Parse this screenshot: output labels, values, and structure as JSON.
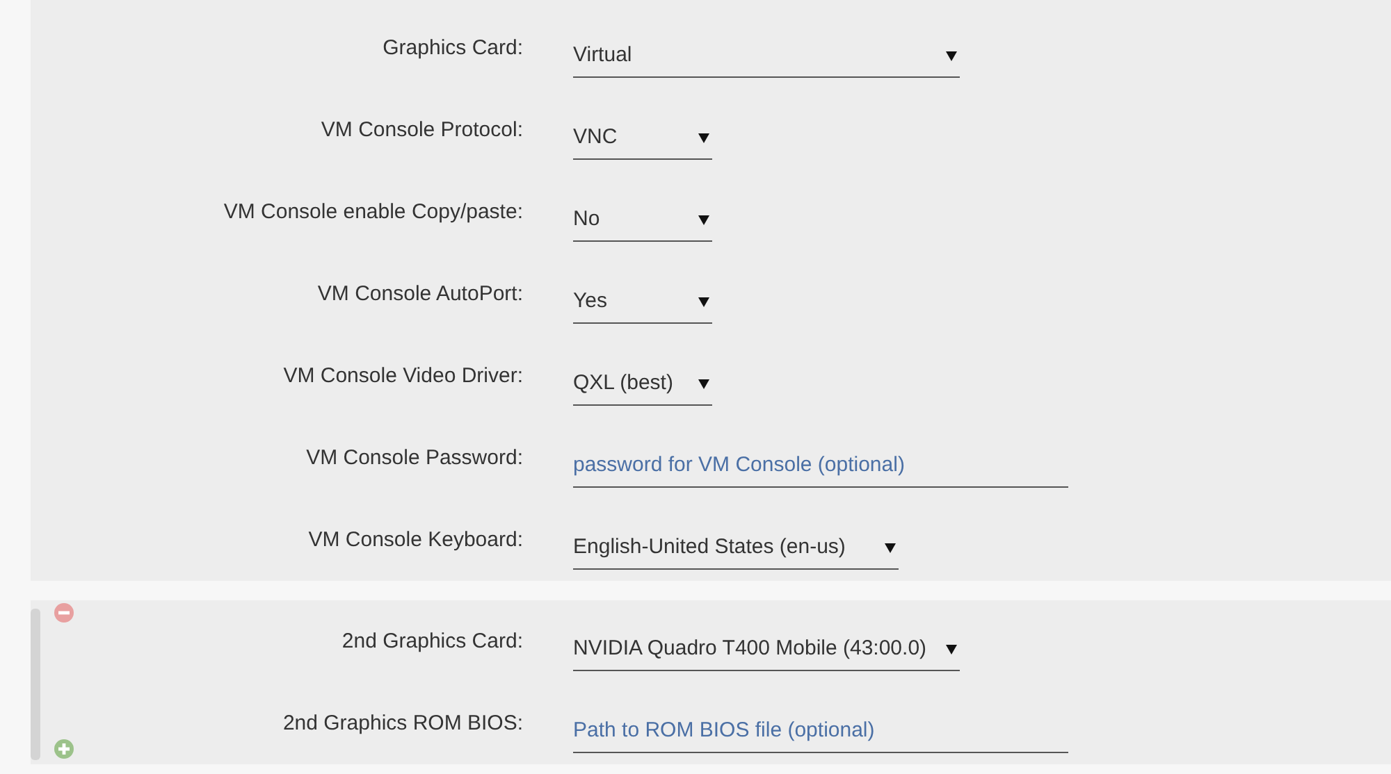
{
  "sections": [
    {
      "rows": [
        {
          "label": "Graphics Card:",
          "kind": "select",
          "value": "Virtual"
        },
        {
          "label": "VM Console Protocol:",
          "kind": "select",
          "value": "VNC"
        },
        {
          "label": "VM Console enable Copy/paste:",
          "kind": "select",
          "value": "No"
        },
        {
          "label": "VM Console AutoPort:",
          "kind": "select",
          "value": "Yes"
        },
        {
          "label": "VM Console Video Driver:",
          "kind": "select",
          "value": "QXL (best)"
        },
        {
          "label": "VM Console Password:",
          "kind": "input",
          "placeholder": "password for VM Console (optional)"
        },
        {
          "label": "VM Console Keyboard:",
          "kind": "select",
          "value": "English-United States (en-us)"
        }
      ]
    },
    {
      "removable": true,
      "addable": true,
      "rows": [
        {
          "label": "2nd Graphics Card:",
          "kind": "select",
          "value": "NVIDIA Quadro T400 Mobile (43:00.0)"
        },
        {
          "label": "2nd Graphics ROM BIOS:",
          "kind": "input",
          "placeholder": "Path to ROM BIOS file (optional)"
        }
      ]
    }
  ]
}
